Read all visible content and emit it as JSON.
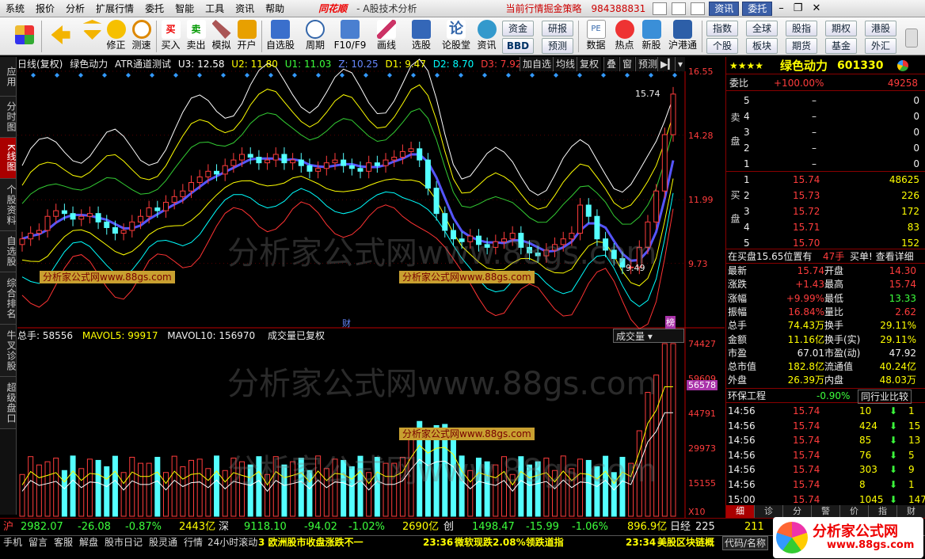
{
  "menu": {
    "items": [
      "系统",
      "报价",
      "分析",
      "扩展行情",
      "委托",
      "智能",
      "工具",
      "资讯",
      "帮助"
    ],
    "logo": "同花顺",
    "subtitle": "- A股技术分析",
    "strategy": "当前行情掘金策略",
    "phone": "984388831",
    "news_btn": "资讯",
    "trade_btn": "委托"
  },
  "toolbar": {
    "buttons": [
      "修正",
      "测速",
      "买入",
      "卖出",
      "模拟",
      "开户",
      "自选股",
      "周期",
      "F10/F9",
      "画线",
      "选股",
      "论股堂",
      "资讯",
      "数据",
      "热点",
      "新股",
      "沪港通"
    ],
    "quick": [
      [
        "资金",
        "研报"
      ],
      [
        "BBD",
        "预测"
      ],
      [
        "指数",
        "全球",
        "股指",
        "期权",
        "港股"
      ],
      [
        "个股",
        "板块",
        "期货",
        "基金",
        "外汇"
      ]
    ]
  },
  "left_tabs": [
    "应用",
    "分时图",
    "K线图",
    "个股资料",
    "自选股",
    "综合排名",
    "牛叉诊股",
    "超级盘口"
  ],
  "chart": {
    "info_period": "日线(复权)",
    "stock_name": "绿色动力",
    "indicator": "ATR通道测试",
    "u3": "U3: 12.58",
    "u2": "U2: 11.80",
    "u1": "U1: 11.03",
    "z": "Z: 10.25",
    "d1": "D1: 9.47",
    "d2": "D2: 8.70",
    "d3": "D3: 7.92",
    "btn_add": "加自选",
    "btn_ma": "均线",
    "btn_fq": "复权",
    "btn_overlay": "叠",
    "btn_window": "窗",
    "btn_forecast": "预测",
    "high_label": "15.74",
    "low_label": "9.49",
    "axis": [
      "16.55",
      "14.28",
      "11.99",
      "9.73"
    ],
    "cai": "财",
    "bang": "榜",
    "vol_total": "总手: 58556",
    "mavol5": "MAVOL5: 99917",
    "mavol10": "MAVOL10: 156970",
    "vol_note": "成交量已复权",
    "vol_select": "成交量",
    "vol_axis": [
      "74427",
      "59609",
      "44791",
      "29973",
      "15155",
      "X10"
    ],
    "vol_mark": "56578",
    "watermark": "分析家公式网www.88gs.com",
    "wm_small": "分析家公式网www.88gs.com"
  },
  "chart_data": {
    "type": "candlestick",
    "title": "",
    "x": [],
    "close_path": [
      10.6,
      10.8,
      10.9,
      11.4,
      11.6,
      11.5,
      11.3,
      11.4,
      11.5,
      11.2,
      11.0,
      10.8,
      10.9,
      11.2,
      11.4,
      11.7,
      11.6,
      11.9,
      12.1,
      12.3,
      12.6,
      12.8,
      13.0,
      12.9,
      13.2,
      13.4,
      13.6,
      13.5,
      13.3,
      13.4,
      13.6,
      13.3,
      13.4,
      13.2,
      13.0,
      13.1,
      13.3,
      13.4,
      13.2,
      13.1,
      13.0,
      13.3,
      13.2,
      13.4,
      13.5,
      13.7,
      13.8,
      13.4,
      12.4,
      11.5,
      10.9,
      10.6,
      10.5,
      10.7,
      10.4,
      10.3,
      10.5,
      10.6,
      10.8,
      10.3,
      10.1,
      10.0,
      10.2,
      10.4,
      10.6,
      10.8,
      11.8,
      11.4,
      10.6,
      10.2,
      9.9,
      9.6,
      9.6,
      10.3,
      11.2,
      12.3,
      14.3,
      15.74
    ],
    "ylim": [
      7.5,
      16.55
    ]
  },
  "right": {
    "stars": "★★★★",
    "name": "绿色动力",
    "code": "601330",
    "weibi_label": "委比",
    "weibi": "+100.00%",
    "weibi_v": "49258",
    "sell": [
      {
        "n": "5",
        "p": "–",
        "v": "0"
      },
      {
        "n": "4",
        "p": "–",
        "v": "0"
      },
      {
        "n": "3",
        "p": "–",
        "v": "0"
      },
      {
        "n": "2",
        "p": "–",
        "v": "0"
      },
      {
        "n": "1",
        "p": "–",
        "v": "0"
      }
    ],
    "buy": [
      {
        "n": "1",
        "p": "15.74",
        "v": "48625"
      },
      {
        "n": "2",
        "p": "15.73",
        "v": "226"
      },
      {
        "n": "3",
        "p": "15.72",
        "v": "172"
      },
      {
        "n": "4",
        "p": "15.71",
        "v": "83"
      },
      {
        "n": "5",
        "p": "15.70",
        "v": "152"
      }
    ],
    "sell_label": "卖盘",
    "buy_label": "买盘",
    "pos": "在买盘15.65位置有",
    "pos_v": "47手",
    "pos_t": "买单! 查看详细",
    "stats": [
      [
        "最新",
        "15.74",
        "开盘",
        "14.30"
      ],
      [
        "涨跌",
        "+1.43",
        "最高",
        "15.74"
      ],
      [
        "涨幅",
        "+9.99%",
        "最低",
        "13.33"
      ],
      [
        "振幅",
        "16.84%",
        "量比",
        "2.62"
      ],
      [
        "总手",
        "74.43万",
        "换手",
        "29.11%"
      ],
      [
        "金额",
        "11.16亿",
        "换手(实)",
        "29.11%"
      ],
      [
        "市盈",
        "67.01",
        "市盈(动)",
        "47.92"
      ],
      [
        "总市值",
        "182.8亿",
        "流通值",
        "40.24亿"
      ],
      [
        "外盘",
        "26.39万",
        "内盘",
        "48.03万"
      ]
    ],
    "industry": "环保工程",
    "industry_pct": "-0.90%",
    "compare": "同行业比较",
    "ticks": [
      [
        "14:56",
        "15.74",
        "10",
        "1"
      ],
      [
        "14:56",
        "15.74",
        "424",
        "15"
      ],
      [
        "14:56",
        "15.74",
        "85",
        "13"
      ],
      [
        "14:56",
        "15.74",
        "76",
        "5"
      ],
      [
        "14:56",
        "15.74",
        "303",
        "9"
      ],
      [
        "14:56",
        "15.74",
        "8",
        "1"
      ],
      [
        "15:00",
        "15.74",
        "1045",
        "147"
      ]
    ],
    "tabs": [
      "细",
      "诊",
      "分",
      "警",
      "价",
      "指",
      "财"
    ]
  },
  "indexbar": {
    "sh": "沪",
    "sh_v": "2982.07",
    "sh_c": "-26.08",
    "sh_p": "-0.87%",
    "sh_a": "2443亿",
    "sz": "深",
    "sz_v": "9118.10",
    "sz_c": "-94.02",
    "sz_p": "-1.02%",
    "sz_a": "2690亿",
    "cy": "创",
    "cy_v": "1498.47",
    "cy_c": "-15.99",
    "cy_p": "-1.06%",
    "cy_a": "896.9亿",
    "nk": "日经",
    "nk_v": "225",
    "x": "211"
  },
  "statusbar": {
    "items": [
      "手机",
      "留言",
      "客服",
      "解盘",
      "股市日记",
      "股灵通",
      "行情",
      "24小时滚动"
    ],
    "news1": "3 欧洲股市收盘涨跌不一",
    "news2_t": "23:36",
    "news2": "微软现跌2.08%领跌道指",
    "news3_t": "23:34",
    "news3": "美股区块链概",
    "code": "代码/名称",
    "brand": "分析家公式网",
    "brand_url": "www.88gs.com"
  }
}
